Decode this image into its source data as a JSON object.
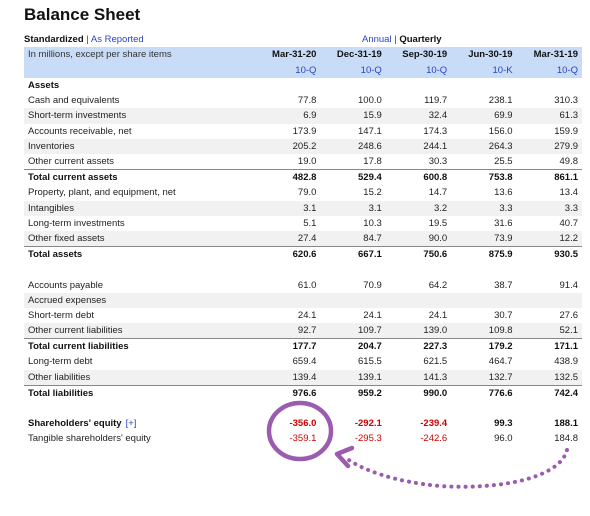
{
  "title": "Balance Sheet",
  "view": {
    "standardized": "Standardized",
    "separator": "|",
    "as_reported": "As Reported",
    "annual": "Annual",
    "quarterly": "Quarterly"
  },
  "header": {
    "note": "In millions, except per share items",
    "dates": [
      "Mar-31-20",
      "Dec-31-19",
      "Sep-30-19",
      "Jun-30-19",
      "Mar-31-19"
    ],
    "forms": [
      "10-Q",
      "10-Q",
      "10-Q",
      "10-K",
      "10-Q"
    ]
  },
  "rows": [
    {
      "label": "Assets",
      "type": "section",
      "values": [
        "",
        "",
        "",
        "",
        ""
      ]
    },
    {
      "label": "Cash and equivalents",
      "type": "item",
      "values": [
        "77.8",
        "100.0",
        "119.7",
        "238.1",
        "310.3"
      ]
    },
    {
      "label": "Short-term investments",
      "type": "item",
      "values": [
        "6.9",
        "15.9",
        "32.4",
        "69.9",
        "61.3"
      ]
    },
    {
      "label": "Accounts receivable, net",
      "type": "item",
      "values": [
        "173.9",
        "147.1",
        "174.3",
        "156.0",
        "159.9"
      ]
    },
    {
      "label": "Inventories",
      "type": "item",
      "values": [
        "205.2",
        "248.6",
        "244.1",
        "264.3",
        "279.9"
      ]
    },
    {
      "label": "Other current assets",
      "type": "item",
      "values": [
        "19.0",
        "17.8",
        "30.3",
        "25.5",
        "49.8"
      ]
    },
    {
      "label": "Total current assets",
      "type": "total",
      "values": [
        "482.8",
        "529.4",
        "600.8",
        "753.8",
        "861.1"
      ]
    },
    {
      "label": "Property, plant, and equipment, net",
      "type": "item",
      "values": [
        "79.0",
        "15.2",
        "14.7",
        "13.6",
        "13.4"
      ]
    },
    {
      "label": "Intangibles",
      "type": "item",
      "values": [
        "3.1",
        "3.1",
        "3.2",
        "3.3",
        "3.3"
      ]
    },
    {
      "label": "Long-term investments",
      "type": "item",
      "values": [
        "5.1",
        "10.3",
        "19.5",
        "31.6",
        "40.7"
      ]
    },
    {
      "label": "Other fixed assets",
      "type": "item",
      "values": [
        "27.4",
        "84.7",
        "90.0",
        "73.9",
        "12.2"
      ]
    },
    {
      "label": "Total assets",
      "type": "total",
      "values": [
        "620.6",
        "667.1",
        "750.6",
        "875.9",
        "930.5"
      ]
    },
    {
      "label": "",
      "type": "blank",
      "values": [
        "",
        "",
        "",
        "",
        ""
      ]
    },
    {
      "label": "Accounts payable",
      "type": "item",
      "values": [
        "61.0",
        "70.9",
        "64.2",
        "38.7",
        "91.4"
      ]
    },
    {
      "label": "Accrued expenses",
      "type": "item",
      "values": [
        "",
        "",
        "",
        "",
        ""
      ]
    },
    {
      "label": "Short-term debt",
      "type": "item",
      "values": [
        "24.1",
        "24.1",
        "24.1",
        "30.7",
        "27.6"
      ]
    },
    {
      "label": "Other current liabilities",
      "type": "item",
      "values": [
        "92.7",
        "109.7",
        "139.0",
        "109.8",
        "52.1"
      ]
    },
    {
      "label": "Total current liabilities",
      "type": "total",
      "values": [
        "177.7",
        "204.7",
        "227.3",
        "179.2",
        "171.1"
      ]
    },
    {
      "label": "Long-term debt",
      "type": "item",
      "values": [
        "659.4",
        "615.5",
        "621.5",
        "464.7",
        "438.9"
      ]
    },
    {
      "label": "Other liabilities",
      "type": "item",
      "values": [
        "139.4",
        "139.1",
        "141.3",
        "132.7",
        "132.5"
      ]
    },
    {
      "label": "Total liabilities",
      "type": "total",
      "values": [
        "976.6",
        "959.2",
        "990.0",
        "776.6",
        "742.4"
      ]
    },
    {
      "label": "",
      "type": "blank",
      "values": [
        "",
        "",
        "",
        "",
        ""
      ]
    },
    {
      "label": "Shareholders' equity",
      "type": "equity",
      "expand": "[+]",
      "values": [
        "-356.0",
        "-292.1",
        "-239.4",
        "99.3",
        "188.1"
      ]
    },
    {
      "label": "Tangible shareholders' equity",
      "type": "item",
      "values": [
        "-359.1",
        "-295.3",
        "-242.6",
        "96.0",
        "184.8"
      ]
    }
  ],
  "colors": {
    "header_bg": "#c9dcf7",
    "link": "#2a44c2",
    "negative": "#d00000",
    "annotation": "#9b5cb0"
  }
}
